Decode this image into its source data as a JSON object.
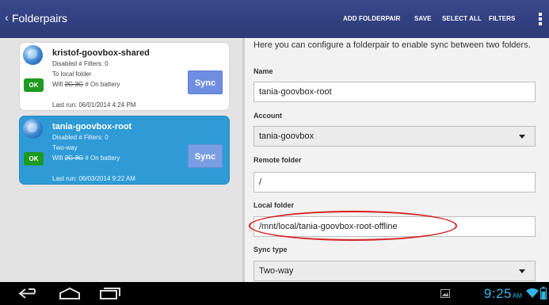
{
  "actionbar": {
    "title": "Folderpairs",
    "actions": [
      "ADD FOLDERPAIR",
      "SAVE",
      "SELECT ALL",
      "FILTERS"
    ]
  },
  "folderpairs": [
    {
      "name": "kristof-goovbox-shared",
      "info": "Disabled # Filters: 0",
      "direction": "To local folder",
      "conditions_prefix": "Wifi ",
      "conditions_struck": "2G 3G",
      "conditions_suffix": " # On battery",
      "status": "OK",
      "sync_label": "Sync",
      "last_run": "Last run: 06/01/2014 4:24 PM",
      "selected": false
    },
    {
      "name": "tania-goovbox-root",
      "info": "Disabled # Filters: 0",
      "direction": "Two-way",
      "conditions_prefix": "Wifi ",
      "conditions_struck": "2G 3G",
      "conditions_suffix": " # On battery",
      "status": "OK",
      "sync_label": "Sync",
      "last_run": "Last run: 06/03/2014 9:22 AM",
      "selected": true
    }
  ],
  "detail": {
    "intro": "Here you can configure a folderpair to enable sync between two folders.",
    "name_label": "Name",
    "name_value": "tania-goovbox-root",
    "account_label": "Account",
    "account_value": "tania-goovbox",
    "remote_label": "Remote folder",
    "remote_value": "/",
    "local_label": "Local folder",
    "local_value": "/mnt/local/tania-goovbox-root-offline",
    "synctype_label": "Sync type",
    "synctype_value": "Two-way"
  },
  "statusbar": {
    "time": "9:25",
    "ampm": "AM"
  },
  "colors": {
    "actionbar": "#2c3a78",
    "selected_card": "#2e9bd6",
    "ok_badge": "#1d9a20",
    "highlight_ellipse": "#d41e1e",
    "status_accent": "#33b5e5"
  },
  "icons": [
    "back-nav-icon",
    "home-nav-icon",
    "recents-nav-icon",
    "picture-notification-icon",
    "wifi-icon",
    "battery-icon",
    "globe-icon",
    "overflow-menu-icon"
  ]
}
